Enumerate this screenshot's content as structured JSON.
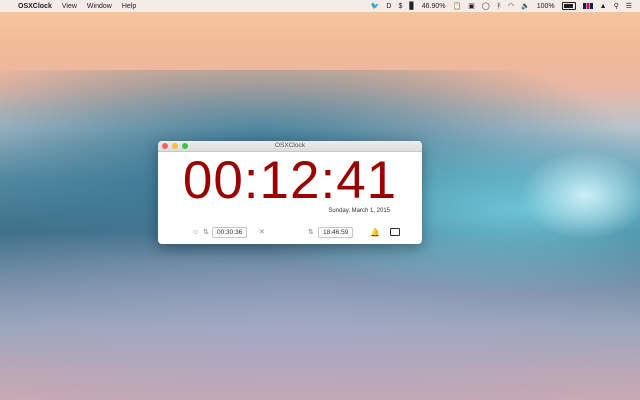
{
  "menubar": {
    "app_name": "OSXClock",
    "menus": [
      "View",
      "Window",
      "Help"
    ],
    "status": {
      "cpu_percent": "46.90%",
      "battery": "100%"
    }
  },
  "window": {
    "title": "OSXClock",
    "elapsed": "00:12:41",
    "date": "Sunday, March 1, 2015",
    "timer_value": "00:30:36",
    "alarm_time": "18:46:59"
  },
  "colors": {
    "clock_red": "#990000",
    "menubar_bg": "#f5f0ee"
  },
  "icons": {
    "apple": "apple-icon",
    "twitter": "twitter-bird-icon",
    "wifi": "wifi-icon",
    "flag": "uk-flag-icon",
    "user": "user-icon",
    "search": "search-icon",
    "list": "list-icon",
    "bell": "bell-icon"
  }
}
